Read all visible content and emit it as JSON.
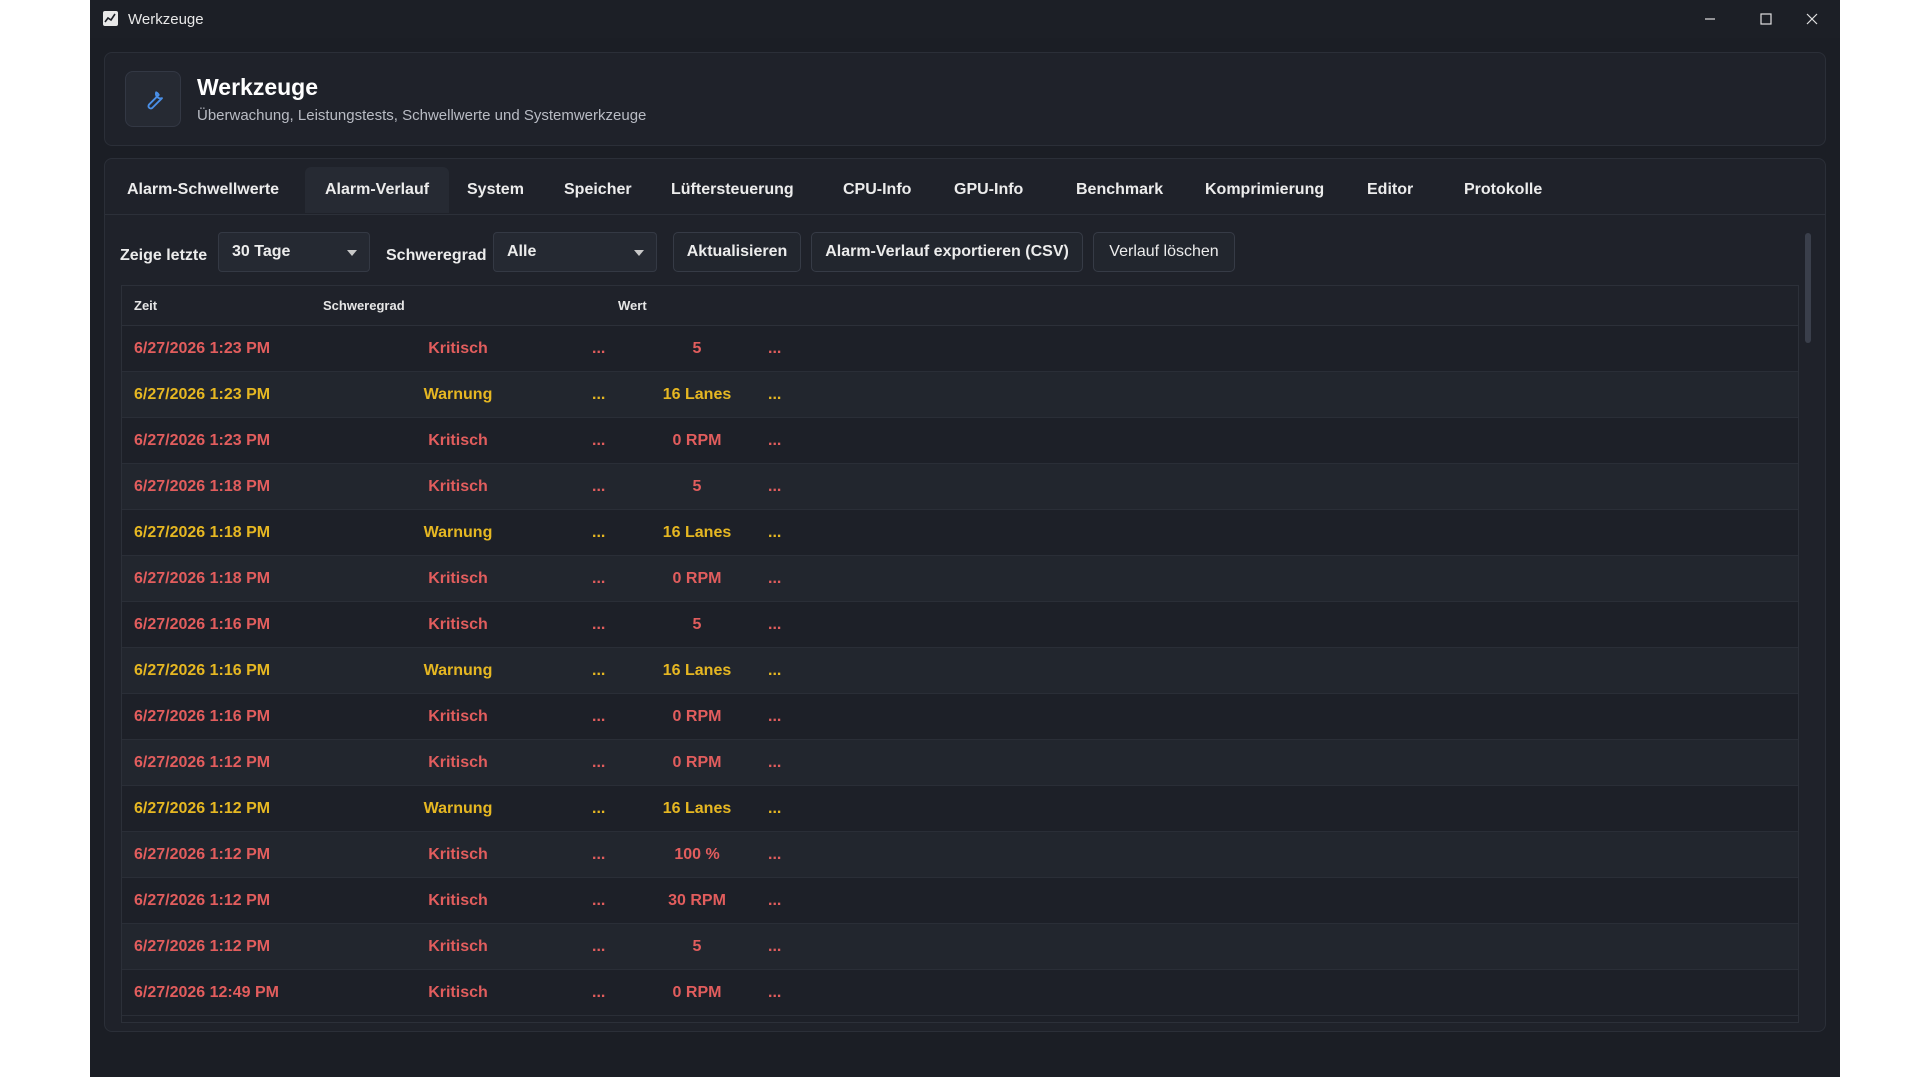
{
  "window": {
    "title": "Werkzeuge",
    "controls": [
      "minimize",
      "maximize",
      "close"
    ]
  },
  "header": {
    "icon": "wrench-icon",
    "title": "Werkzeuge",
    "subtitle": "Überwachung, Leistungstests, Schwellwerte und Systemwerkzeuge"
  },
  "tabs": [
    {
      "label": "Alarm-Schwellwerte"
    },
    {
      "label": "Alarm-Verlauf",
      "active": true
    },
    {
      "label": "System"
    },
    {
      "label": "Speicher"
    },
    {
      "label": "Lüftersteuerung"
    },
    {
      "label": "CPU-Info"
    },
    {
      "label": "GPU-Info"
    },
    {
      "label": "Benchmark"
    },
    {
      "label": "Komprimierung"
    },
    {
      "label": "Editor"
    },
    {
      "label": "Protokolle"
    }
  ],
  "toolbar": {
    "show_last_label": "Zeige letzte",
    "show_last_value": "30 Tage",
    "severity_label": "Schweregrad",
    "severity_value": "Alle",
    "refresh_label": "Aktualisieren",
    "export_label": "Alarm-Verlauf exportieren (CSV)",
    "clear_label": "Verlauf löschen"
  },
  "table": {
    "columns": [
      "Zeit",
      "Schweregrad",
      "Wert"
    ],
    "rows": [
      {
        "time": "6/27/2026 1:23 PM",
        "severity": "Kritisch",
        "dots1": "...",
        "value": "5",
        "dots2": "..."
      },
      {
        "time": "6/27/2026 1:23 PM",
        "severity": "Warnung",
        "dots1": "...",
        "value": "16 Lanes",
        "dots2": "..."
      },
      {
        "time": "6/27/2026 1:23 PM",
        "severity": "Kritisch",
        "dots1": "...",
        "value": "0 RPM",
        "dots2": "..."
      },
      {
        "time": "6/27/2026 1:18 PM",
        "severity": "Kritisch",
        "dots1": "...",
        "value": "5",
        "dots2": "..."
      },
      {
        "time": "6/27/2026 1:18 PM",
        "severity": "Warnung",
        "dots1": "...",
        "value": "16 Lanes",
        "dots2": "..."
      },
      {
        "time": "6/27/2026 1:18 PM",
        "severity": "Kritisch",
        "dots1": "...",
        "value": "0 RPM",
        "dots2": "..."
      },
      {
        "time": "6/27/2026 1:16 PM",
        "severity": "Kritisch",
        "dots1": "...",
        "value": "5",
        "dots2": "..."
      },
      {
        "time": "6/27/2026 1:16 PM",
        "severity": "Warnung",
        "dots1": "...",
        "value": "16 Lanes",
        "dots2": "..."
      },
      {
        "time": "6/27/2026 1:16 PM",
        "severity": "Kritisch",
        "dots1": "...",
        "value": "0 RPM",
        "dots2": "..."
      },
      {
        "time": "6/27/2026 1:12 PM",
        "severity": "Kritisch",
        "dots1": "...",
        "value": "0 RPM",
        "dots2": "..."
      },
      {
        "time": "6/27/2026 1:12 PM",
        "severity": "Warnung",
        "dots1": "...",
        "value": "16 Lanes",
        "dots2": "..."
      },
      {
        "time": "6/27/2026 1:12 PM",
        "severity": "Kritisch",
        "dots1": "...",
        "value": "100 %",
        "dots2": "..."
      },
      {
        "time": "6/27/2026 1:12 PM",
        "severity": "Kritisch",
        "dots1": "...",
        "value": "30 RPM",
        "dots2": "..."
      },
      {
        "time": "6/27/2026 1:12 PM",
        "severity": "Kritisch",
        "dots1": "...",
        "value": "5",
        "dots2": "..."
      },
      {
        "time": "6/27/2026 12:49 PM",
        "severity": "Kritisch",
        "dots1": "...",
        "value": "0 RPM",
        "dots2": "..."
      }
    ]
  },
  "colors": {
    "critical": "#e25d5d",
    "warning": "#e6b722",
    "accent": "#4a8fe7"
  }
}
